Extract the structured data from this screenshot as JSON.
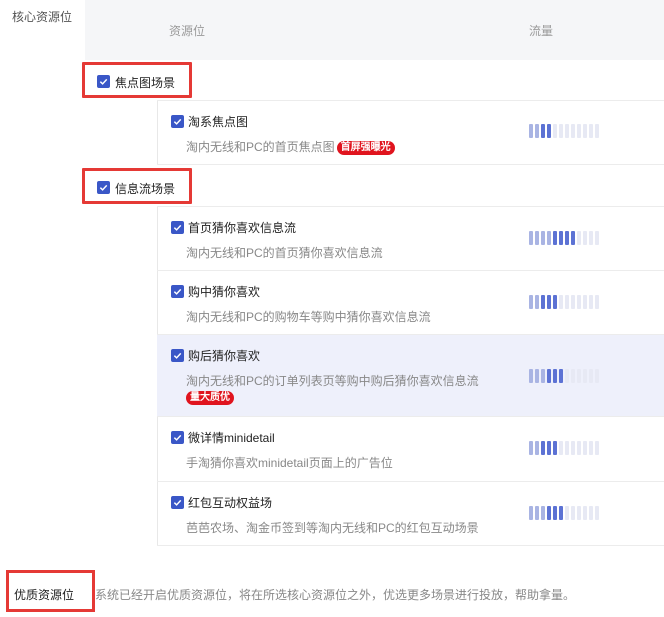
{
  "section_label": "核心资源位",
  "table": {
    "col_name": "资源位",
    "col_flow": "流量"
  },
  "groups": [
    {
      "label": "焦点图场景",
      "items": [
        {
          "title": "淘系焦点图",
          "desc": "淘内无线和PC的首页焦点图",
          "badge": "首屏强曝光",
          "flow_level": 0.3
        }
      ]
    },
    {
      "label": "信息流场景",
      "items": [
        {
          "title": "首页猜你喜欢信息流",
          "desc": "淘内无线和PC的首页猜你喜欢信息流",
          "flow_level": 0.7
        },
        {
          "title": "购中猜你喜欢",
          "desc": "淘内无线和PC的购物车等购中猜你喜欢信息流",
          "flow_level": 0.4
        },
        {
          "title": "购后猜你喜欢",
          "desc": "淘内无线和PC的订单列表页等购中购后猜你喜欢信息流",
          "badge": "量大质优",
          "flow_level": 0.5
        },
        {
          "title": "微详情minidetail",
          "desc": "手淘猜你喜欢minidetail页面上的广告位",
          "flow_level": 0.4
        },
        {
          "title": "红包互动权益场",
          "desc": "芭芭农场、淘金币签到等淘内无线和PC的红包互动场景",
          "flow_level": 0.5
        }
      ]
    }
  ],
  "footer": {
    "label": "优质资源位",
    "text": "系统已经开启优质资源位，将在所选核心资源位之外，优选更多场景进行投放，帮助拿量。"
  },
  "colors": {
    "accent": "#3a57c7",
    "highlight_row": "#eef0fb",
    "badge": "#e0141e",
    "callout": "#e53935"
  }
}
